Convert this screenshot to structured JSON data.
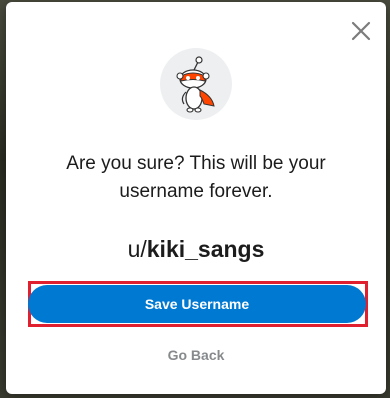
{
  "modal": {
    "question": "Are you sure? This will be your username forever.",
    "username_prefix": "u/",
    "username": "kiki_sangs",
    "save_label": "Save Username",
    "go_back_label": "Go Back"
  },
  "icons": {
    "close": "close-icon",
    "avatar": "reddit-snoo-avatar-icon"
  },
  "colors": {
    "primary_button": "#0079d3",
    "highlight_outline": "#e0202e",
    "muted_text": "#878a8c",
    "avatar_bg": "#edeff1"
  }
}
